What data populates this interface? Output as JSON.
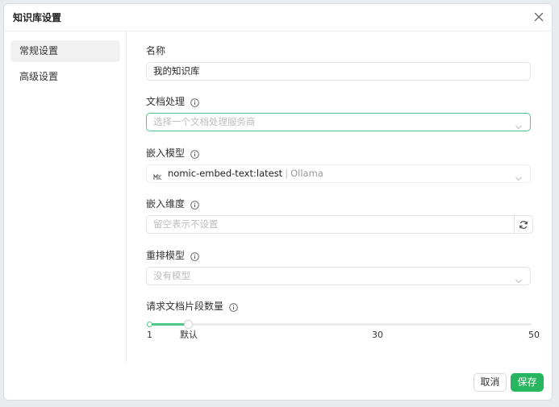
{
  "dialog": {
    "title": "知识库设置"
  },
  "sidebar": {
    "items": [
      {
        "label": "常规设置",
        "active": true
      },
      {
        "label": "高级设置",
        "active": false
      }
    ]
  },
  "form": {
    "name": {
      "label": "名称",
      "value": "我的知识库"
    },
    "doc_processing": {
      "label": "文档处理",
      "placeholder": "选择一个文档处理服务商"
    },
    "embed_model": {
      "label": "嵌入模型",
      "model": "nomic-embed-text:latest",
      "separator": "|",
      "provider": "Ollama"
    },
    "embed_dimension": {
      "label": "嵌入维度",
      "placeholder": "留空表示不设置"
    },
    "rerank_model": {
      "label": "重排模型",
      "placeholder": "没有模型"
    },
    "chunk_count": {
      "label": "请求文档片段数量",
      "min": 1,
      "max": 50,
      "value": 6,
      "marks": {
        "min_label": "1",
        "default_label": "默认",
        "mid_label": "30",
        "max_label": "50"
      }
    }
  },
  "footer": {
    "cancel_label": "取消",
    "save_label": "保存"
  },
  "colors": {
    "accent": "#28b55f",
    "focus_border": "#52c785"
  }
}
